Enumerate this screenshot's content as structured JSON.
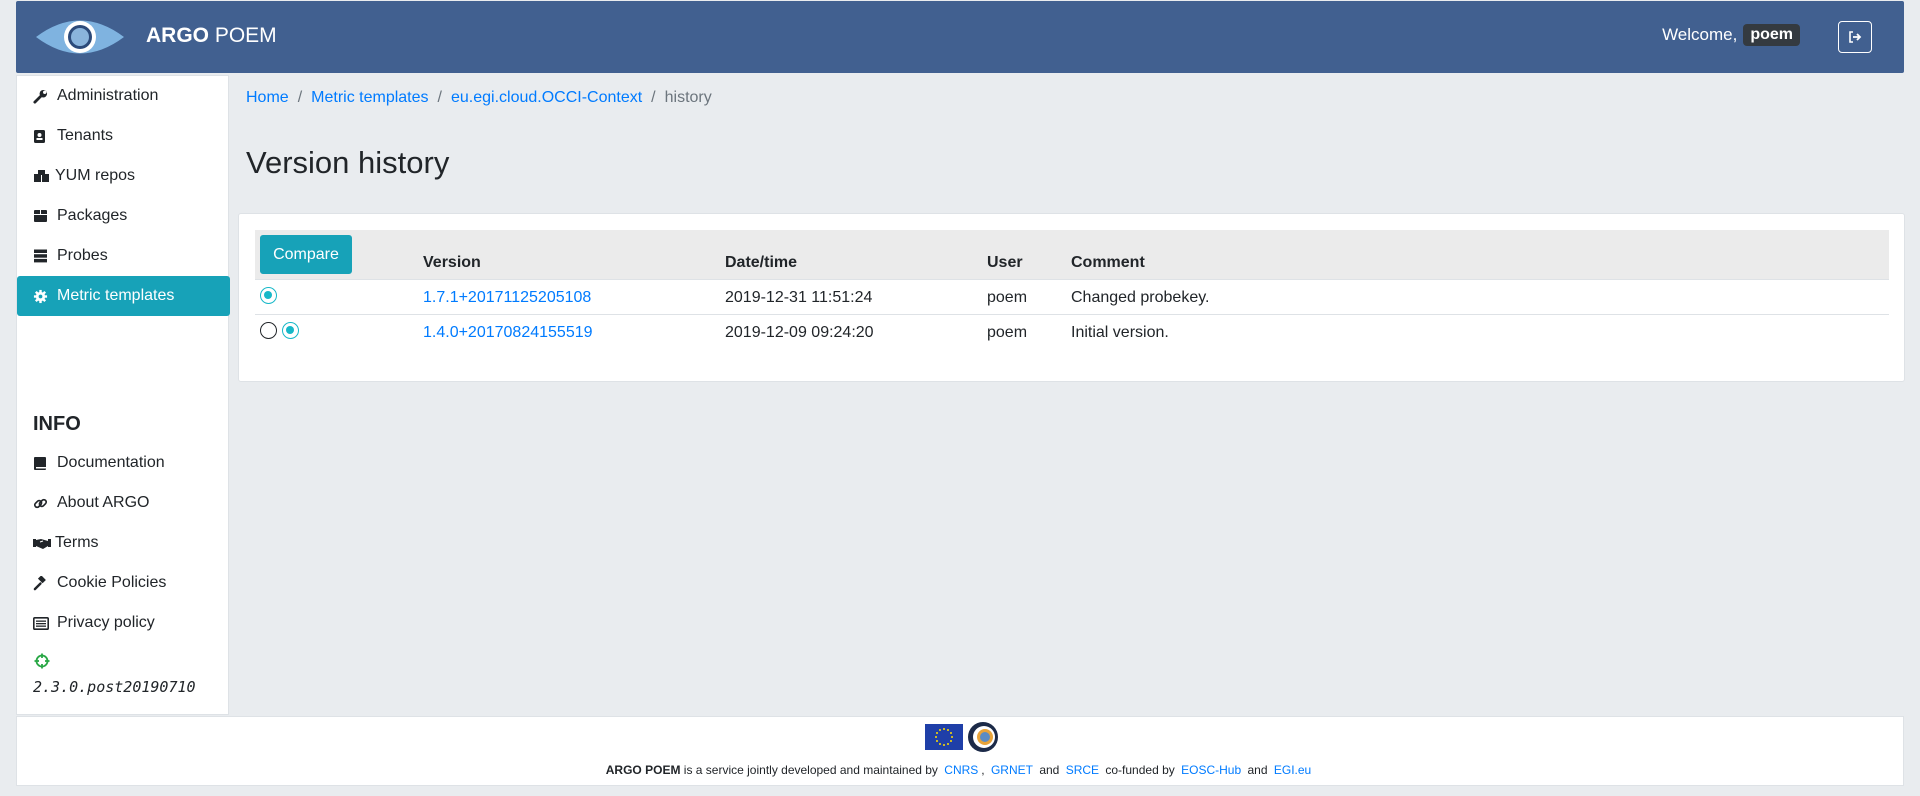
{
  "header": {
    "brand_bold": "ARGO",
    "brand_rest": " POEM",
    "welcome_label": "Welcome,",
    "username": "poem"
  },
  "sidebar": {
    "items": [
      {
        "label": "Administration",
        "icon": "wrench-icon"
      },
      {
        "label": "Tenants",
        "icon": "id-badge-icon"
      },
      {
        "label": "YUM repos",
        "icon": "boxes-icon"
      },
      {
        "label": "Packages",
        "icon": "box-icon"
      },
      {
        "label": "Probes",
        "icon": "server-icon"
      },
      {
        "label": "Metric templates",
        "icon": "cog-icon",
        "active": true
      }
    ],
    "info_title": "INFO",
    "info_items": [
      {
        "label": "Documentation",
        "icon": "book-icon"
      },
      {
        "label": "About ARGO",
        "icon": "link-icon"
      },
      {
        "label": "Terms",
        "icon": "handshake-icon"
      },
      {
        "label": "Cookie Policies",
        "icon": "gavel-icon"
      },
      {
        "label": "Privacy policy",
        "icon": "list-alt-icon"
      }
    ],
    "version": "2.3.0.post20190710"
  },
  "breadcrumb": {
    "home": "Home",
    "metric_templates": "Metric templates",
    "template": "eu.egi.cloud.OCCI-Context",
    "current": "history"
  },
  "page": {
    "title": "Version history"
  },
  "table": {
    "compare_label": "Compare",
    "headers": [
      "Version",
      "Date/time",
      "User",
      "Comment"
    ],
    "rows": [
      {
        "version": "1.7.1+20171125205108",
        "datetime": "2019-12-31 11:51:24",
        "user": "poem",
        "comment": "Changed probekey."
      },
      {
        "version": "1.4.0+20170824155519",
        "datetime": "2019-12-09 09:24:20",
        "user": "poem",
        "comment": "Initial version."
      }
    ]
  },
  "footer": {
    "brand": "ARGO POEM",
    "text1": "is a service jointly developed and maintained by",
    "link_cnrs": "CNRS",
    "link_grnet": "GRNET",
    "and1": "and",
    "link_srce": "SRCE",
    "text2": "co-funded by",
    "link_eosc": "EOSC-Hub",
    "and2": "and",
    "link_egi": "EGI.eu"
  },
  "colors": {
    "header_bg": "#416090",
    "accent": "#17a2b8",
    "link": "#007bff"
  }
}
